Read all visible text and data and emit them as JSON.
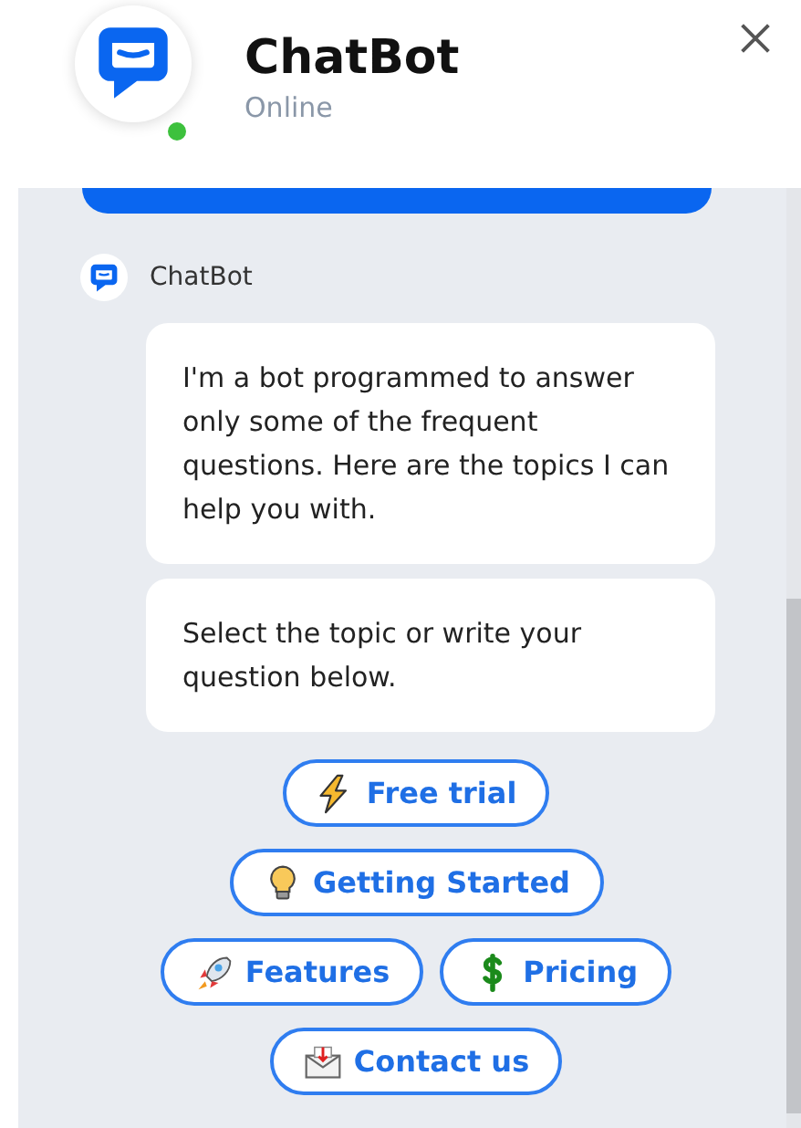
{
  "header": {
    "title": "ChatBot",
    "status": "Online",
    "online": true
  },
  "sender": "ChatBot",
  "messages": [
    "I'm a bot programmed to answer only some of the frequent questions. Here are the topics I can help you with.",
    "Select the topic or write your question below."
  ],
  "quick_replies": [
    [
      "Free trial"
    ],
    [
      "Getting Started"
    ],
    [
      "Features",
      "Pricing"
    ],
    [
      "Contact us"
    ]
  ]
}
